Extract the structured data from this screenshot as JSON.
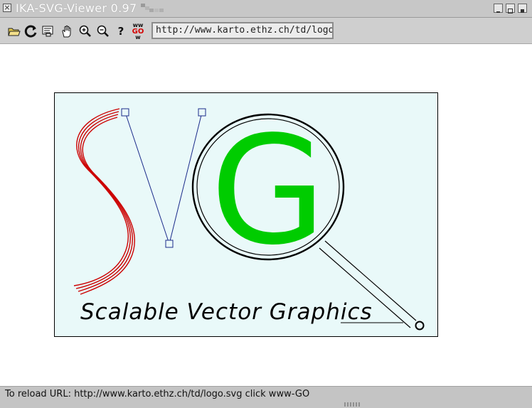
{
  "window": {
    "title": "IKA-SVG-Viewer 0.97"
  },
  "toolbar": {
    "buttons": [
      {
        "icon": "open-folder-icon"
      },
      {
        "icon": "reload-icon"
      },
      {
        "icon": "view-source-icon"
      },
      {
        "icon": "hand-pan-icon"
      },
      {
        "icon": "zoom-in-icon"
      },
      {
        "icon": "zoom-out-icon"
      },
      {
        "icon": "help-icon",
        "label": "?"
      },
      {
        "icon": "www-go-icon",
        "label_top": "ww",
        "label_mid": "GO",
        "label_bot": "w"
      }
    ],
    "url_value": "http://www.karto.ethz.ch/td/logo.svg"
  },
  "logo": {
    "caption": "Scalable Vector Graphics",
    "glyph": "G",
    "colors": {
      "background": "#e9f9f9",
      "s_stroke": "#cc0000",
      "g_fill": "#00cc00",
      "v_line": "#1a2a8a",
      "lens": "#000000"
    }
  },
  "status": {
    "text": "To reload URL: http://www.karto.ethz.ch/td/logo.svg click www-GO"
  }
}
